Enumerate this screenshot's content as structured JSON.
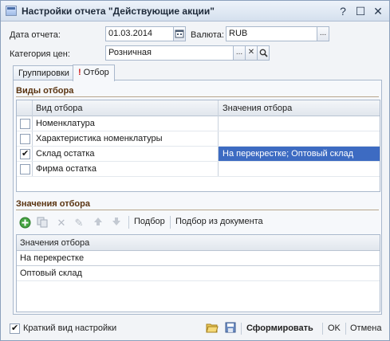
{
  "window": {
    "title": "Настройки отчета  \"Действующие акции\"",
    "help_label": "?",
    "maximize_label": "☐",
    "close_label": "✕"
  },
  "header": {
    "date_label": "Дата отчета:",
    "date_value": "01.03.2014",
    "currency_label": "Валюта:",
    "currency_value": "RUB",
    "price_category_label": "Категория цен:",
    "price_category_value": "Розничная",
    "select_button_label": "...",
    "clear_button_label": "✕",
    "search_button_label": "⚲"
  },
  "tabs": [
    {
      "label": "Группировки"
    },
    {
      "mark": "!",
      "label": "Отбор"
    }
  ],
  "filter_types": {
    "section_title": "Виды отбора",
    "columns": [
      "Вид отбора",
      "Значения отбора"
    ],
    "rows": [
      {
        "name": "Номенклатура",
        "checked": false,
        "value": ""
      },
      {
        "name": "Характеристика номенклатуры",
        "checked": false,
        "value": ""
      },
      {
        "name": "Склад остатка",
        "checked": true,
        "value": "На перекрестке; Оптовый склад"
      },
      {
        "name": "Фирма остатка",
        "checked": false,
        "value": ""
      }
    ]
  },
  "filter_values": {
    "section_title": "Значения отбора",
    "toolbar": {
      "pick_label": "Подбор",
      "pick_from_doc_label": "Подбор из документа"
    },
    "column": "Значения отбора",
    "rows": [
      "На перекрестке",
      "Оптовый склад"
    ]
  },
  "footer": {
    "short_view_label": "Краткий вид настройки",
    "short_view_checked": true,
    "generate_label": "Сформировать",
    "ok_label": "OK",
    "cancel_label": "Отмена"
  },
  "colors": {
    "selection": "#3d6bc2",
    "section_title": "#5a3410",
    "required_mark": "#d02020"
  },
  "icons": [
    "window-icon",
    "calendar-icon",
    "add-icon",
    "copy-icon",
    "delete-icon",
    "edit-icon",
    "move-up-icon",
    "move-down-icon",
    "open-folder-icon",
    "save-icon"
  ]
}
